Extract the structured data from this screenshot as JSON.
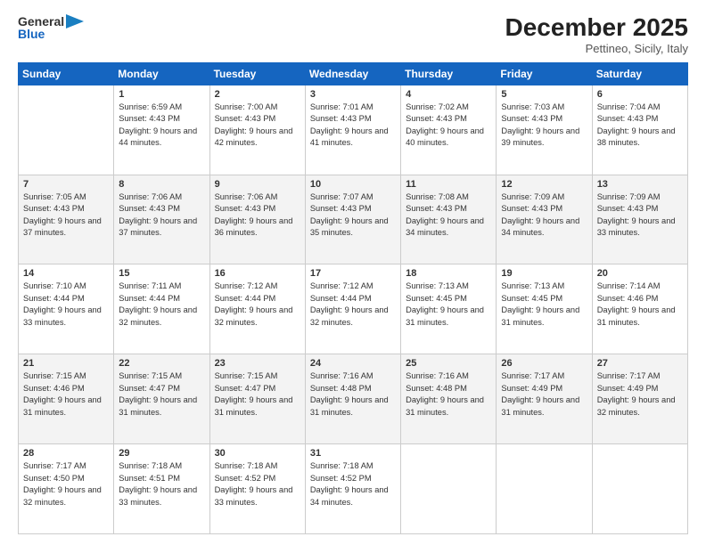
{
  "logo": {
    "line1": "General",
    "line2": "Blue"
  },
  "title": "December 2025",
  "subtitle": "Pettineo, Sicily, Italy",
  "weekdays": [
    "Sunday",
    "Monday",
    "Tuesday",
    "Wednesday",
    "Thursday",
    "Friday",
    "Saturday"
  ],
  "weeks": [
    [
      {
        "day": "",
        "sunrise": "",
        "sunset": "",
        "daylight": ""
      },
      {
        "day": "1",
        "sunrise": "Sunrise: 6:59 AM",
        "sunset": "Sunset: 4:43 PM",
        "daylight": "Daylight: 9 hours and 44 minutes."
      },
      {
        "day": "2",
        "sunrise": "Sunrise: 7:00 AM",
        "sunset": "Sunset: 4:43 PM",
        "daylight": "Daylight: 9 hours and 42 minutes."
      },
      {
        "day": "3",
        "sunrise": "Sunrise: 7:01 AM",
        "sunset": "Sunset: 4:43 PM",
        "daylight": "Daylight: 9 hours and 41 minutes."
      },
      {
        "day": "4",
        "sunrise": "Sunrise: 7:02 AM",
        "sunset": "Sunset: 4:43 PM",
        "daylight": "Daylight: 9 hours and 40 minutes."
      },
      {
        "day": "5",
        "sunrise": "Sunrise: 7:03 AM",
        "sunset": "Sunset: 4:43 PM",
        "daylight": "Daylight: 9 hours and 39 minutes."
      },
      {
        "day": "6",
        "sunrise": "Sunrise: 7:04 AM",
        "sunset": "Sunset: 4:43 PM",
        "daylight": "Daylight: 9 hours and 38 minutes."
      }
    ],
    [
      {
        "day": "7",
        "sunrise": "Sunrise: 7:05 AM",
        "sunset": "Sunset: 4:43 PM",
        "daylight": "Daylight: 9 hours and 37 minutes."
      },
      {
        "day": "8",
        "sunrise": "Sunrise: 7:06 AM",
        "sunset": "Sunset: 4:43 PM",
        "daylight": "Daylight: 9 hours and 37 minutes."
      },
      {
        "day": "9",
        "sunrise": "Sunrise: 7:06 AM",
        "sunset": "Sunset: 4:43 PM",
        "daylight": "Daylight: 9 hours and 36 minutes."
      },
      {
        "day": "10",
        "sunrise": "Sunrise: 7:07 AM",
        "sunset": "Sunset: 4:43 PM",
        "daylight": "Daylight: 9 hours and 35 minutes."
      },
      {
        "day": "11",
        "sunrise": "Sunrise: 7:08 AM",
        "sunset": "Sunset: 4:43 PM",
        "daylight": "Daylight: 9 hours and 34 minutes."
      },
      {
        "day": "12",
        "sunrise": "Sunrise: 7:09 AM",
        "sunset": "Sunset: 4:43 PM",
        "daylight": "Daylight: 9 hours and 34 minutes."
      },
      {
        "day": "13",
        "sunrise": "Sunrise: 7:09 AM",
        "sunset": "Sunset: 4:43 PM",
        "daylight": "Daylight: 9 hours and 33 minutes."
      }
    ],
    [
      {
        "day": "14",
        "sunrise": "Sunrise: 7:10 AM",
        "sunset": "Sunset: 4:44 PM",
        "daylight": "Daylight: 9 hours and 33 minutes."
      },
      {
        "day": "15",
        "sunrise": "Sunrise: 7:11 AM",
        "sunset": "Sunset: 4:44 PM",
        "daylight": "Daylight: 9 hours and 32 minutes."
      },
      {
        "day": "16",
        "sunrise": "Sunrise: 7:12 AM",
        "sunset": "Sunset: 4:44 PM",
        "daylight": "Daylight: 9 hours and 32 minutes."
      },
      {
        "day": "17",
        "sunrise": "Sunrise: 7:12 AM",
        "sunset": "Sunset: 4:44 PM",
        "daylight": "Daylight: 9 hours and 32 minutes."
      },
      {
        "day": "18",
        "sunrise": "Sunrise: 7:13 AM",
        "sunset": "Sunset: 4:45 PM",
        "daylight": "Daylight: 9 hours and 31 minutes."
      },
      {
        "day": "19",
        "sunrise": "Sunrise: 7:13 AM",
        "sunset": "Sunset: 4:45 PM",
        "daylight": "Daylight: 9 hours and 31 minutes."
      },
      {
        "day": "20",
        "sunrise": "Sunrise: 7:14 AM",
        "sunset": "Sunset: 4:46 PM",
        "daylight": "Daylight: 9 hours and 31 minutes."
      }
    ],
    [
      {
        "day": "21",
        "sunrise": "Sunrise: 7:15 AM",
        "sunset": "Sunset: 4:46 PM",
        "daylight": "Daylight: 9 hours and 31 minutes."
      },
      {
        "day": "22",
        "sunrise": "Sunrise: 7:15 AM",
        "sunset": "Sunset: 4:47 PM",
        "daylight": "Daylight: 9 hours and 31 minutes."
      },
      {
        "day": "23",
        "sunrise": "Sunrise: 7:15 AM",
        "sunset": "Sunset: 4:47 PM",
        "daylight": "Daylight: 9 hours and 31 minutes."
      },
      {
        "day": "24",
        "sunrise": "Sunrise: 7:16 AM",
        "sunset": "Sunset: 4:48 PM",
        "daylight": "Daylight: 9 hours and 31 minutes."
      },
      {
        "day": "25",
        "sunrise": "Sunrise: 7:16 AM",
        "sunset": "Sunset: 4:48 PM",
        "daylight": "Daylight: 9 hours and 31 minutes."
      },
      {
        "day": "26",
        "sunrise": "Sunrise: 7:17 AM",
        "sunset": "Sunset: 4:49 PM",
        "daylight": "Daylight: 9 hours and 31 minutes."
      },
      {
        "day": "27",
        "sunrise": "Sunrise: 7:17 AM",
        "sunset": "Sunset: 4:49 PM",
        "daylight": "Daylight: 9 hours and 32 minutes."
      }
    ],
    [
      {
        "day": "28",
        "sunrise": "Sunrise: 7:17 AM",
        "sunset": "Sunset: 4:50 PM",
        "daylight": "Daylight: 9 hours and 32 minutes."
      },
      {
        "day": "29",
        "sunrise": "Sunrise: 7:18 AM",
        "sunset": "Sunset: 4:51 PM",
        "daylight": "Daylight: 9 hours and 33 minutes."
      },
      {
        "day": "30",
        "sunrise": "Sunrise: 7:18 AM",
        "sunset": "Sunset: 4:52 PM",
        "daylight": "Daylight: 9 hours and 33 minutes."
      },
      {
        "day": "31",
        "sunrise": "Sunrise: 7:18 AM",
        "sunset": "Sunset: 4:52 PM",
        "daylight": "Daylight: 9 hours and 34 minutes."
      },
      {
        "day": "",
        "sunrise": "",
        "sunset": "",
        "daylight": ""
      },
      {
        "day": "",
        "sunrise": "",
        "sunset": "",
        "daylight": ""
      },
      {
        "day": "",
        "sunrise": "",
        "sunset": "",
        "daylight": ""
      }
    ]
  ]
}
